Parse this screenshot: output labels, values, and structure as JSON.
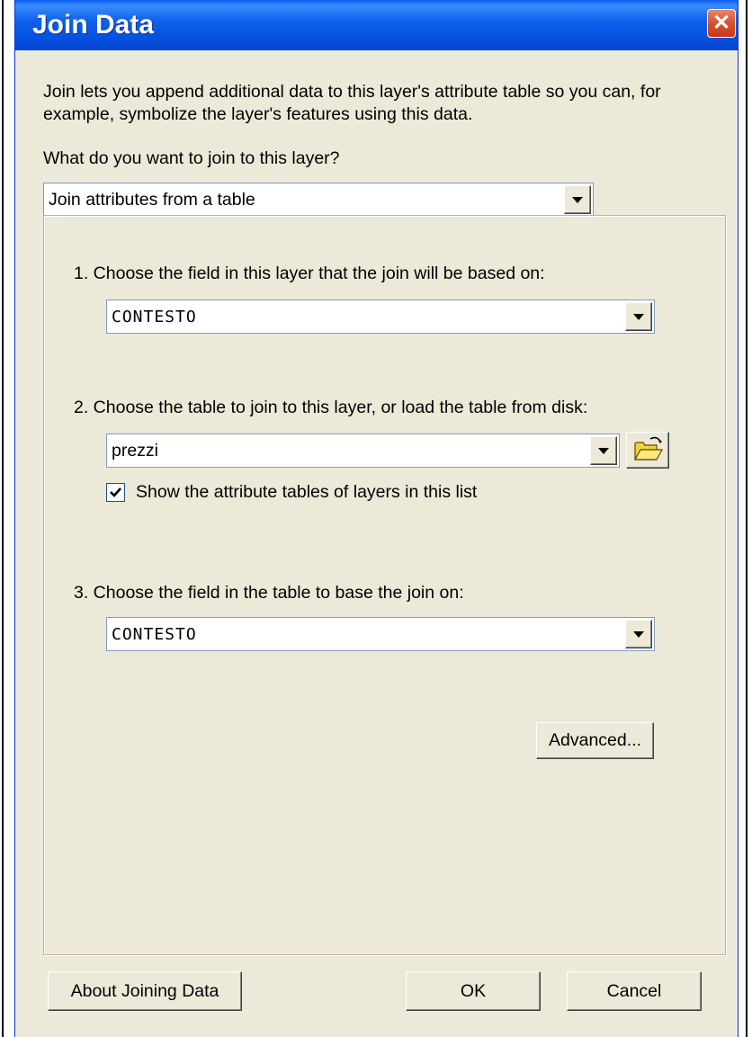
{
  "window": {
    "title": "Join Data",
    "close_glyph": "✕"
  },
  "intro_text": "Join lets you append additional data to this layer's attribute table so you can, for example, symbolize the layer's features using this data.",
  "join_question": "What do you want to join to this layer?",
  "join_type": {
    "value": "Join attributes from a table"
  },
  "step1": {
    "label": "1.  Choose the field in this layer that the join will be based on:",
    "value": "CONTESTO"
  },
  "step2": {
    "label": "2.  Choose the table to join to this layer, or load the table from disk:",
    "value": "prezzi",
    "checkbox_label": "Show the attribute tables of layers in this list",
    "checkbox_checked": true
  },
  "step3": {
    "label": "3.  Choose the field in the table to base the join on:",
    "value": "CONTESTO"
  },
  "buttons": {
    "advanced": "Advanced...",
    "about": "About Joining Data",
    "ok": "OK",
    "cancel": "Cancel"
  },
  "icons": {
    "dropdown": "chevron-down-icon",
    "browse": "open-folder-icon",
    "check": "checkmark-icon"
  },
  "colors": {
    "title_bar": "#0553e3",
    "close_button": "#d9532f",
    "dialog_background": "#ece9d8",
    "folder_icon": "#e8c200"
  }
}
